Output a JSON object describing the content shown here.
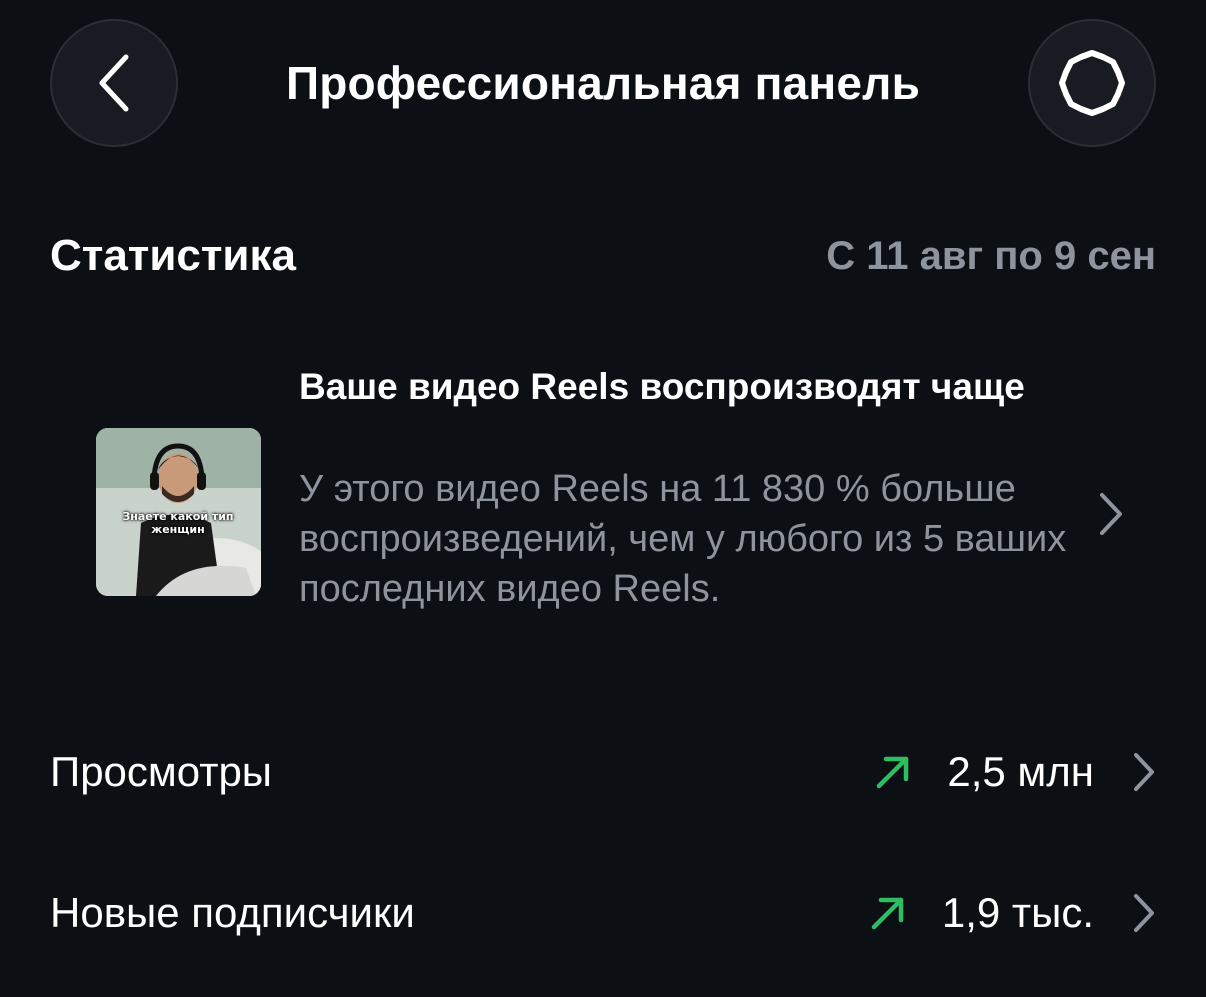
{
  "header": {
    "title": "Профессиональная панель",
    "back_icon": "chevron-left-icon",
    "settings_icon": "gear-icon"
  },
  "stats": {
    "title": "Статистика",
    "date_range": "С 11 авг по 9 сен"
  },
  "highlight": {
    "title": "Ваше видео Reels воспроизводят чаще",
    "description": "У этого видео Reels на 11 830 % больше воспроизведений, чем у любого из 5 ваших последних видео Reels.",
    "thumbnail_caption": "Знаете какой тип женщин"
  },
  "metrics": [
    {
      "label": "Просмотры",
      "value": "2,5 млн",
      "trend": "up"
    },
    {
      "label": "Новые подписчики",
      "value": "1,9 тыс.",
      "trend": "up"
    }
  ],
  "colors": {
    "background": "#0c0f14",
    "secondary_text": "#8e949e",
    "trend_up": "#2dbe60"
  }
}
